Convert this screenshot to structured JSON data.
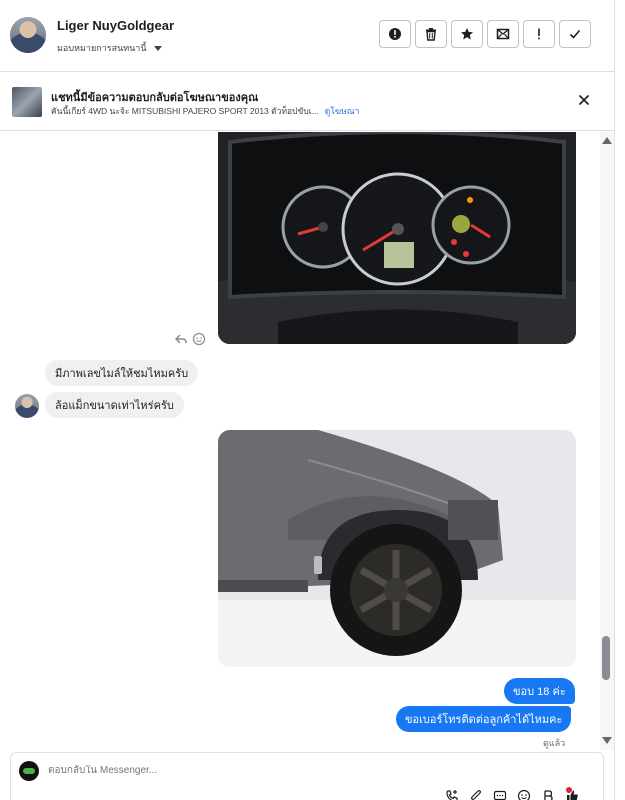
{
  "header": {
    "name": "Liger NuyGoldgear",
    "assign_label": "มอบหมายการสนทนานี้",
    "actions": [
      "mark-spam",
      "delete",
      "star",
      "mark-unread",
      "important",
      "done"
    ]
  },
  "banner": {
    "title": "แชทนี้มีข้อความตอบกลับต่อโฆษณาของคุณ",
    "description": "คันนี้เกียร์ 4WD นะจ้ะ MITSUBISHI PAJERO SPORT 2013 ตัวท็อปขับเ...",
    "link": "ดูโฆษณา"
  },
  "messages": {
    "incoming_1": "มีภาพเลขไมล์ให้ชมไหมครับ",
    "incoming_2": "ล้อแม็กขนาดเท่าไหร่ครับ",
    "outgoing_1": "ขอบ 18 ค่ะ",
    "outgoing_2": "ขอเบอร์โทรติดต่อลูกค้าได้ไหมคะ",
    "seen": "ดูแล้ว"
  },
  "composer": {
    "placeholder": "ตอบกลับใน Messenger..."
  },
  "colors": {
    "accent": "#1877f2",
    "incoming_bubble": "#f0f0f0",
    "border": "#dddfe2",
    "notification": "#e41e3f"
  }
}
